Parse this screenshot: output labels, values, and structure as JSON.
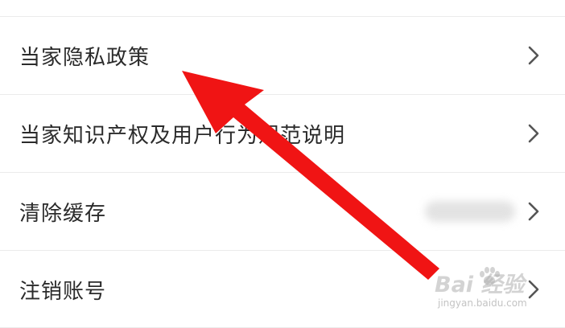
{
  "menu": {
    "items": [
      {
        "label": "当家隐私政策"
      },
      {
        "label": "当家知识产权及用户行为规范说明"
      },
      {
        "label": "清除缓存",
        "value_obscured": true
      },
      {
        "label": "注销账号"
      }
    ]
  },
  "annotation": {
    "arrow_color": "#f01414"
  },
  "watermark": {
    "main": "Bai 经验",
    "sub": "jingyan.baidu.com"
  }
}
